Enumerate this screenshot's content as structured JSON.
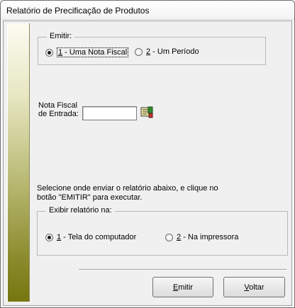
{
  "window": {
    "title": "Relatório de Precificação de Produtos"
  },
  "emitir_group": {
    "label": "Emitir:",
    "options": [
      {
        "key": "1",
        "label": " - Uma Nota Fiscal",
        "selected": true
      },
      {
        "key": "2",
        "label": " - Um Período",
        "selected": false
      }
    ]
  },
  "nota_fiscal": {
    "label_line1": "Nota Fiscal",
    "label_line2": "de Entrada:",
    "value": "",
    "lookup_icon": "document-lookup-icon"
  },
  "instructions": {
    "line1": "Selecione onde enviar o relatório abaixo, e clique no",
    "line2": "botão \"EMITIR\" para executar."
  },
  "exibir_group": {
    "label": "Exibir relatório na:",
    "options": [
      {
        "key": "1",
        "label": " - Tela do computador",
        "selected": true
      },
      {
        "key": "2",
        "label": " - Na impressora",
        "selected": false
      }
    ]
  },
  "buttons": {
    "emitir": {
      "key": "E",
      "rest": "mitir"
    },
    "voltar": {
      "key": "V",
      "rest": "oltar"
    }
  },
  "colors": {
    "sidebar_gradient_end": "#767610",
    "window_bg": "#f0f0f0"
  }
}
